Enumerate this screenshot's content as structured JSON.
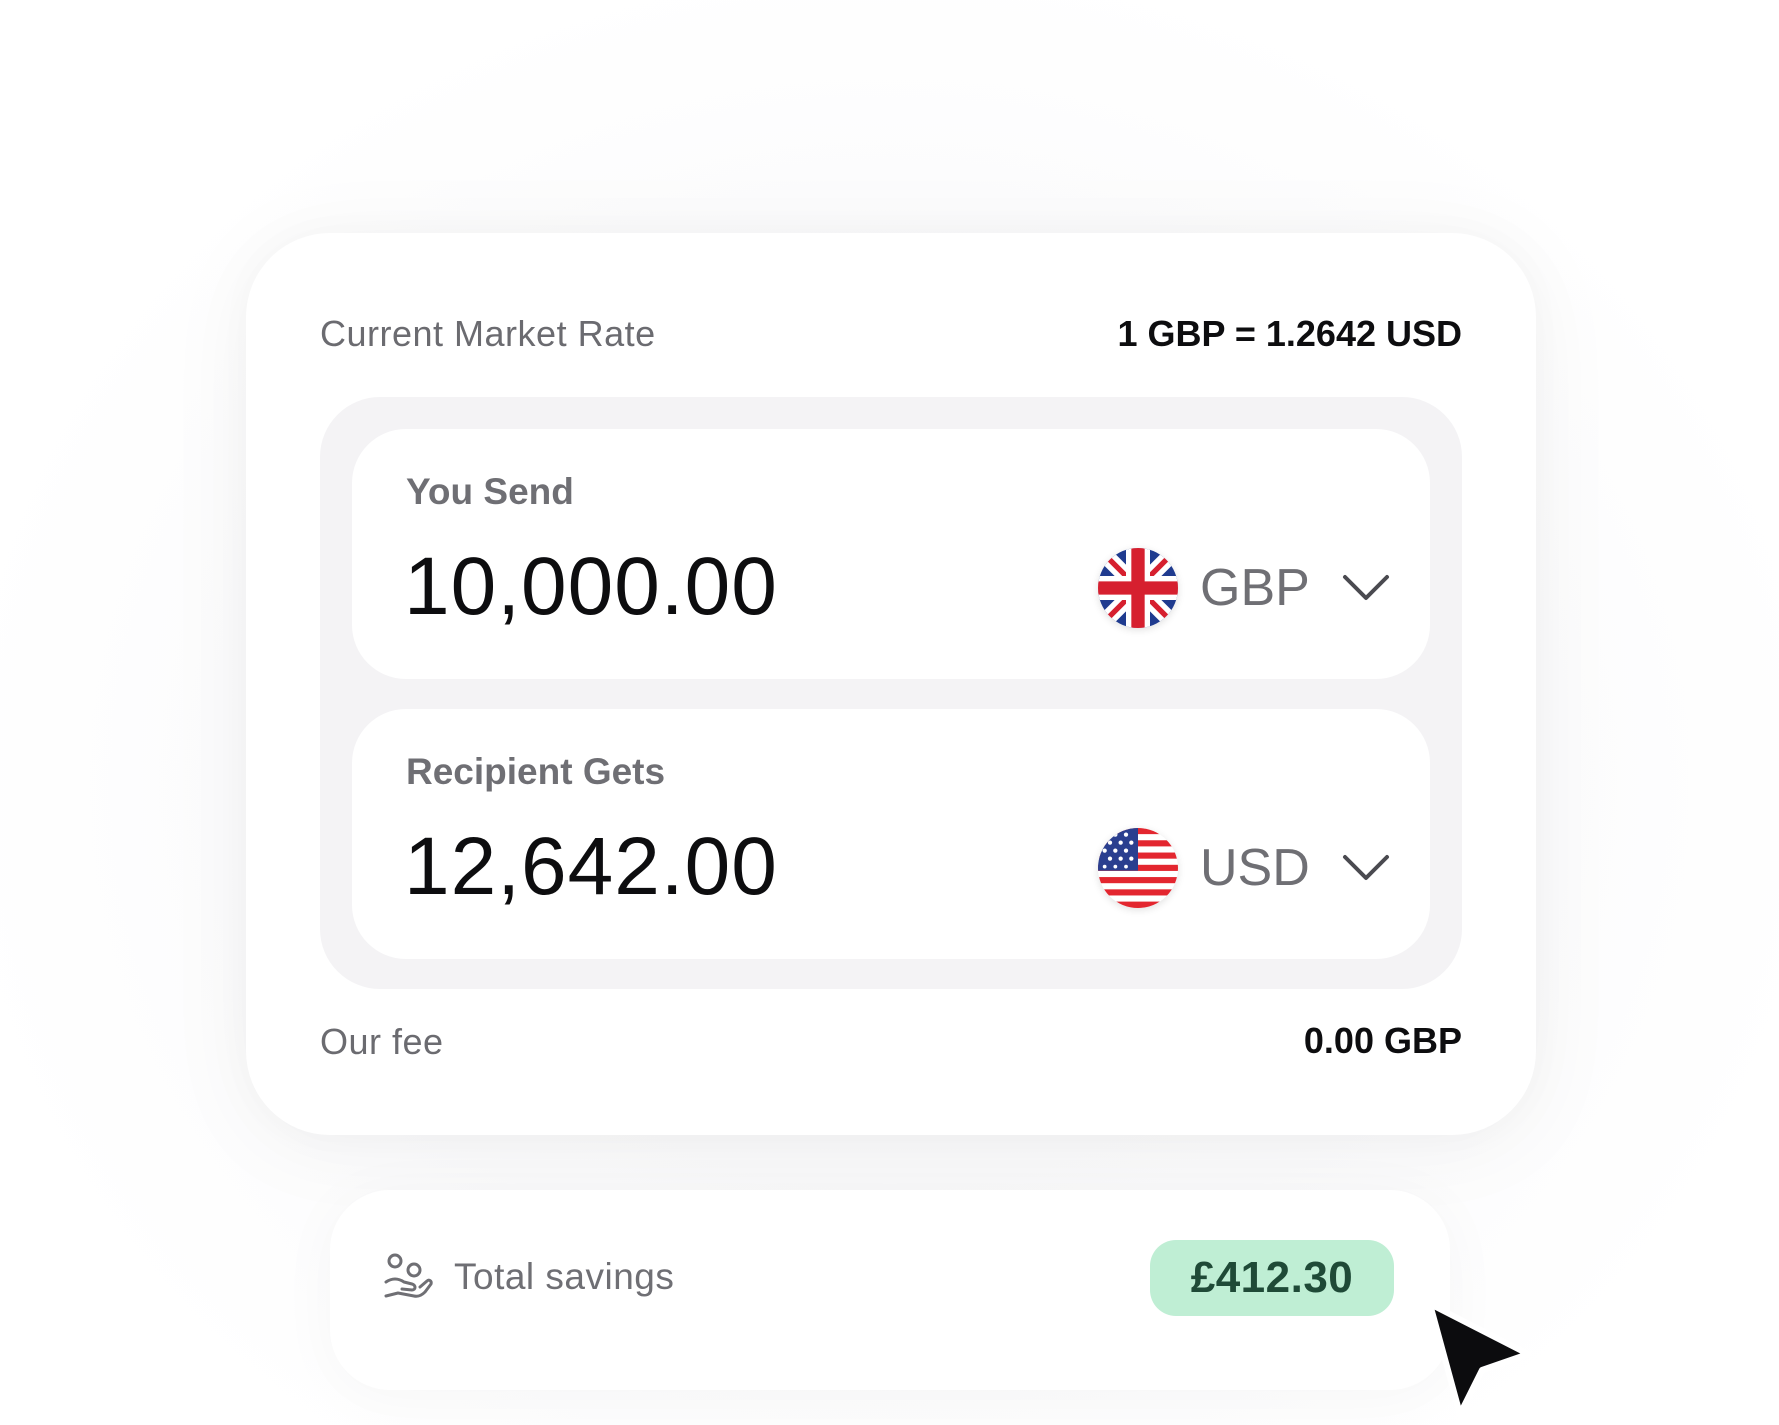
{
  "rate": {
    "label": "Current Market Rate",
    "value": "1 GBP = 1.2642 USD"
  },
  "send": {
    "label": "You Send",
    "amount": "10,000.00",
    "currency": "GBP",
    "flag_icon": "uk-flag-icon"
  },
  "receive": {
    "label": "Recipient Gets",
    "amount": "12,642.00",
    "currency": "USD",
    "flag_icon": "us-flag-icon"
  },
  "fee": {
    "label": "Our fee",
    "value": "0.00 GBP"
  },
  "savings": {
    "label": "Total savings",
    "value": "£412.30",
    "icon": "hand-coins-icon",
    "badge_color": "#bfeed4",
    "badge_text_color": "#1f4a37"
  },
  "colors": {
    "muted_text": "#6f6f74",
    "strong_text": "#0d0d0f",
    "panel_bg": "#f4f3f5"
  }
}
